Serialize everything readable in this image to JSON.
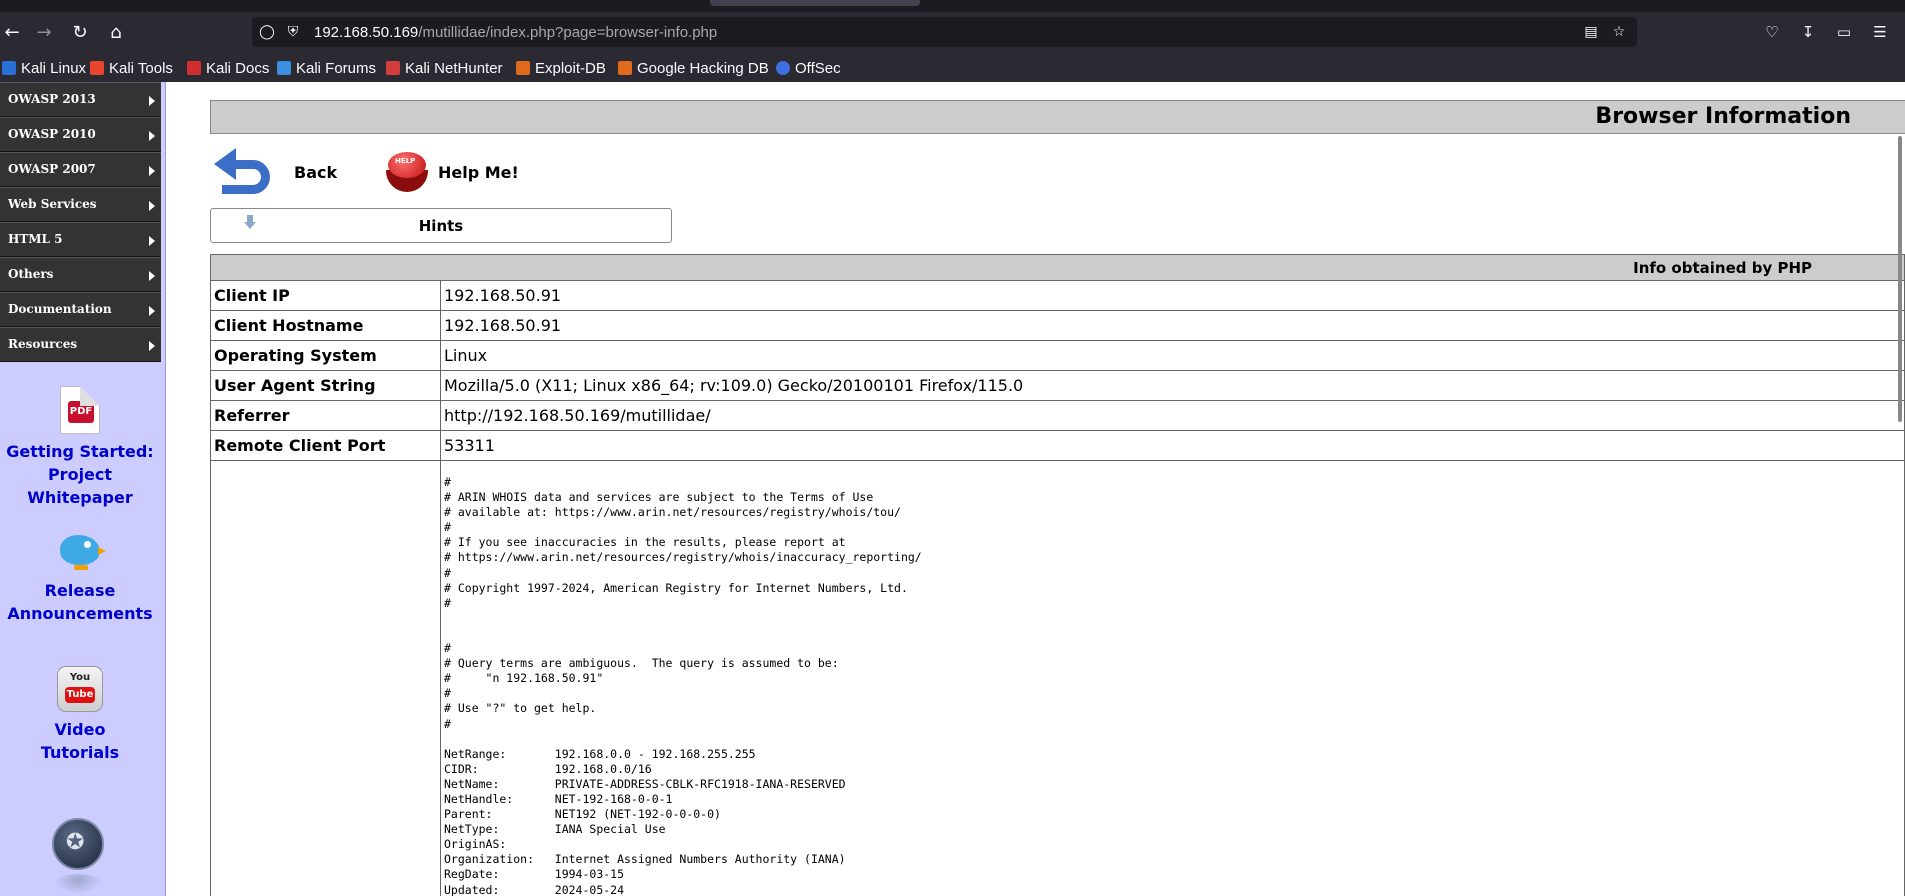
{
  "browser": {
    "url_host": "192.168.50.169",
    "url_path": "/mutillidae/index.php?page=browser-info.php",
    "icons": [
      "back-icon",
      "forward-icon",
      "reload-icon",
      "home-icon",
      "shield-icon",
      "lock-icon",
      "reader-icon",
      "star-icon",
      "pocket-icon",
      "download-icon",
      "extensions-icon",
      "menu-icon"
    ]
  },
  "bookmarks": [
    {
      "label": "Kali Linux",
      "color": "#2a6fd6"
    },
    {
      "label": "Kali Tools",
      "color": "#e8452c"
    },
    {
      "label": "Kali Docs",
      "color": "#d12f2f"
    },
    {
      "label": "Kali Forums",
      "color": "#3d8fe0"
    },
    {
      "label": "Kali NetHunter",
      "color": "#d23c3c"
    },
    {
      "label": "Exploit-DB",
      "color": "#e06a1c"
    },
    {
      "label": "Google Hacking DB",
      "color": "#e06a1c"
    },
    {
      "label": "OffSec",
      "color": "#3f6fe0"
    }
  ],
  "sidebar": {
    "menu": [
      "OWASP 2013",
      "OWASP 2010",
      "OWASP 2007",
      "Web Services",
      "HTML 5",
      "Others",
      "Documentation",
      "Resources"
    ],
    "links": {
      "whitepaper_line1": "Getting Started:",
      "whitepaper_line2": "Project Whitepaper",
      "release_line1": "Release",
      "release_line2": "Announcements",
      "video_line1": "Video",
      "video_line2": "Tutorials"
    },
    "pdf_glyph": "PDF",
    "yt_top": "You",
    "yt_bottom": "Tube"
  },
  "main": {
    "title": "Browser Information",
    "back_label": "Back",
    "help_label": "Help Me!",
    "help_badge": "HELP",
    "hints_label": "Hints",
    "table_header": "Info obtained by PHP",
    "rows": [
      {
        "label": "Client IP",
        "value": "192.168.50.91"
      },
      {
        "label": "Client Hostname",
        "value": "192.168.50.91"
      },
      {
        "label": "Operating System",
        "value": "Linux"
      },
      {
        "label": "User Agent String",
        "value": "Mozilla/5.0 (X11; Linux x86_64; rv:109.0) Gecko/20100101 Firefox/115.0"
      },
      {
        "label": "Referrer",
        "value": "http://192.168.50.169/mutillidae/"
      },
      {
        "label": "Remote Client Port",
        "value": "53311"
      }
    ],
    "whois": "#\n# ARIN WHOIS data and services are subject to the Terms of Use\n# available at: https://www.arin.net/resources/registry/whois/tou/\n#\n# If you see inaccuracies in the results, please report at\n# https://www.arin.net/resources/registry/whois/inaccuracy_reporting/\n#\n# Copyright 1997-2024, American Registry for Internet Numbers, Ltd.\n#\n\n\n#\n# Query terms are ambiguous.  The query is assumed to be:\n#     \"n 192.168.50.91\"\n#\n# Use \"?\" to get help.\n#\n\nNetRange:       192.168.0.0 - 192.168.255.255\nCIDR:           192.168.0.0/16\nNetName:        PRIVATE-ADDRESS-CBLK-RFC1918-IANA-RESERVED\nNetHandle:      NET-192-168-0-0-1\nParent:         NET192 (NET-192-0-0-0-0)\nNetType:        IANA Special Use\nOriginAS:\nOrganization:   Internet Assigned Numbers Authority (IANA)\nRegDate:        1994-03-15\nUpdated:        2024-05-24"
  }
}
